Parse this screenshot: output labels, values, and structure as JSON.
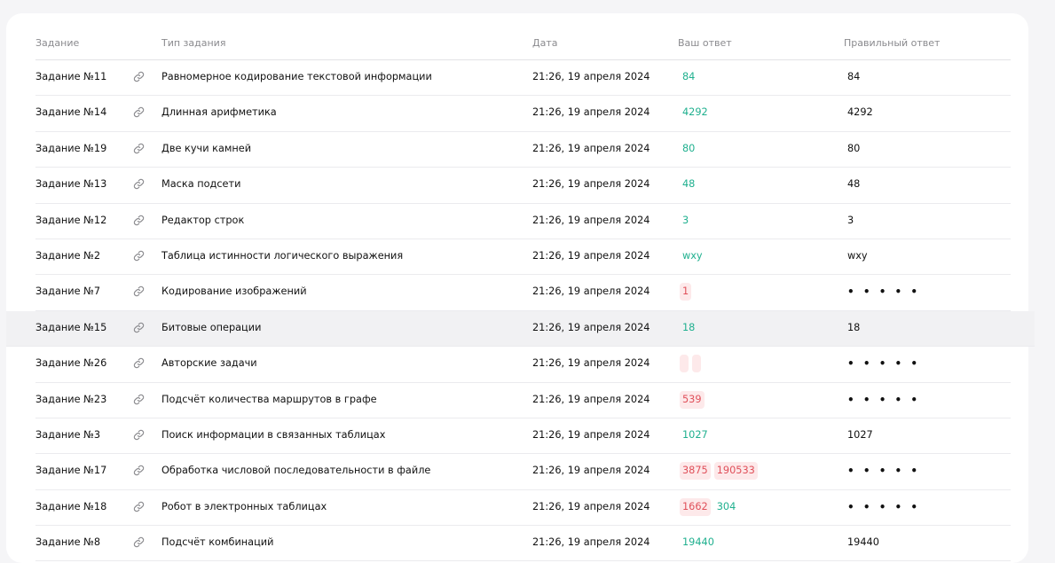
{
  "header": {
    "task": "Задание",
    "type": "Тип задания",
    "date": "Дата",
    "your_answer": "Ваш ответ",
    "correct_answer": "Правильный ответ"
  },
  "rows": [
    {
      "task": "Задание №11",
      "type": "Равномерное кодирование текстовой информации",
      "date": "21:26, 19 апреля 2024",
      "answers": [
        {
          "text": "84",
          "status": "correct"
        }
      ],
      "correct": "84"
    },
    {
      "task": "Задание №14",
      "type": "Длинная арифметика",
      "date": "21:26, 19 апреля 2024",
      "answers": [
        {
          "text": "4292",
          "status": "correct"
        }
      ],
      "correct": "4292"
    },
    {
      "task": "Задание №19",
      "type": "Две кучи камней",
      "date": "21:26, 19 апреля 2024",
      "answers": [
        {
          "text": "80",
          "status": "correct"
        }
      ],
      "correct": "80"
    },
    {
      "task": "Задание №13",
      "type": "Маска подсети",
      "date": "21:26, 19 апреля 2024",
      "answers": [
        {
          "text": "48",
          "status": "correct"
        }
      ],
      "correct": "48"
    },
    {
      "task": "Задание №12",
      "type": "Редактор строк",
      "date": "21:26, 19 апреля 2024",
      "answers": [
        {
          "text": "3",
          "status": "correct"
        }
      ],
      "correct": "3"
    },
    {
      "task": "Задание №2",
      "type": "Таблица истинности логического выражения",
      "date": "21:26, 19 апреля 2024",
      "answers": [
        {
          "text": "wxy",
          "status": "correct"
        }
      ],
      "correct": "wxy"
    },
    {
      "task": "Задание №7",
      "type": "Кодирование изображений",
      "date": "21:26, 19 апреля 2024",
      "answers": [
        {
          "text": "1",
          "status": "wrong"
        }
      ],
      "correct": "• • • • •"
    },
    {
      "task": "Задание №15",
      "type": "Битовые операции",
      "date": "21:26, 19 апреля 2024",
      "answers": [
        {
          "text": "18",
          "status": "correct"
        }
      ],
      "correct": "18",
      "highlighted": true
    },
    {
      "task": "Задание №26",
      "type": "Авторские задачи",
      "date": "21:26, 19 апреля 2024",
      "answers": [
        {
          "text": "",
          "status": "wrong"
        },
        {
          "text": "",
          "status": "wrong"
        }
      ],
      "correct": "• • • • •"
    },
    {
      "task": "Задание №23",
      "type": "Подсчёт количества маршрутов в графе",
      "date": "21:26, 19 апреля 2024",
      "answers": [
        {
          "text": "539",
          "status": "wrong"
        }
      ],
      "correct": "• • • • •"
    },
    {
      "task": "Задание №3",
      "type": "Поиск информации в связанных таблицах",
      "date": "21:26, 19 апреля 2024",
      "answers": [
        {
          "text": "1027",
          "status": "correct"
        }
      ],
      "correct": "1027"
    },
    {
      "task": "Задание №17",
      "type": "Обработка числовой последовательности в файле",
      "date": "21:26, 19 апреля 2024",
      "answers": [
        {
          "text": "3875",
          "status": "wrong"
        },
        {
          "text": "190533",
          "status": "wrong"
        }
      ],
      "correct": "• • • • •"
    },
    {
      "task": "Задание №18",
      "type": "Робот в электронных таблицах",
      "date": "21:26, 19 апреля 2024",
      "answers": [
        {
          "text": "1662",
          "status": "wrong"
        },
        {
          "text": "304",
          "status": "correct"
        }
      ],
      "correct": "• • • • •"
    },
    {
      "task": "Задание №8",
      "type": "Подсчёт комбинаций",
      "date": "21:26, 19 апреля 2024",
      "answers": [
        {
          "text": "19440",
          "status": "correct"
        }
      ],
      "correct": "19440"
    }
  ],
  "icons": {
    "link": "link-icon"
  },
  "colors": {
    "correct": "#20b08f",
    "wrong": "#e0505a",
    "wrong_bg": "#fde9ea"
  }
}
